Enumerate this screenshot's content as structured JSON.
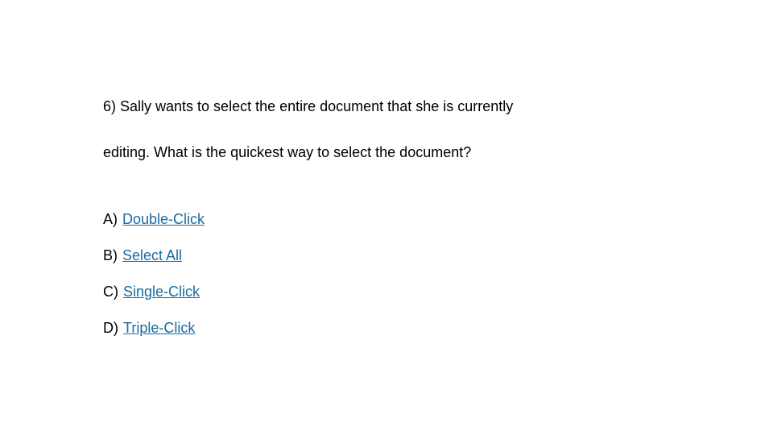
{
  "question": {
    "line1": "6) Sally wants to select the entire document that she is currently",
    "line2": "editing. What is the quickest way to select the document?"
  },
  "options": [
    {
      "prefix": "A)",
      "text": "Double-Click"
    },
    {
      "prefix": "B)",
      "text": "Select All"
    },
    {
      "prefix": "C)",
      "text": "Single-Click"
    },
    {
      "prefix": "D)",
      "text": "Triple-Click"
    }
  ]
}
